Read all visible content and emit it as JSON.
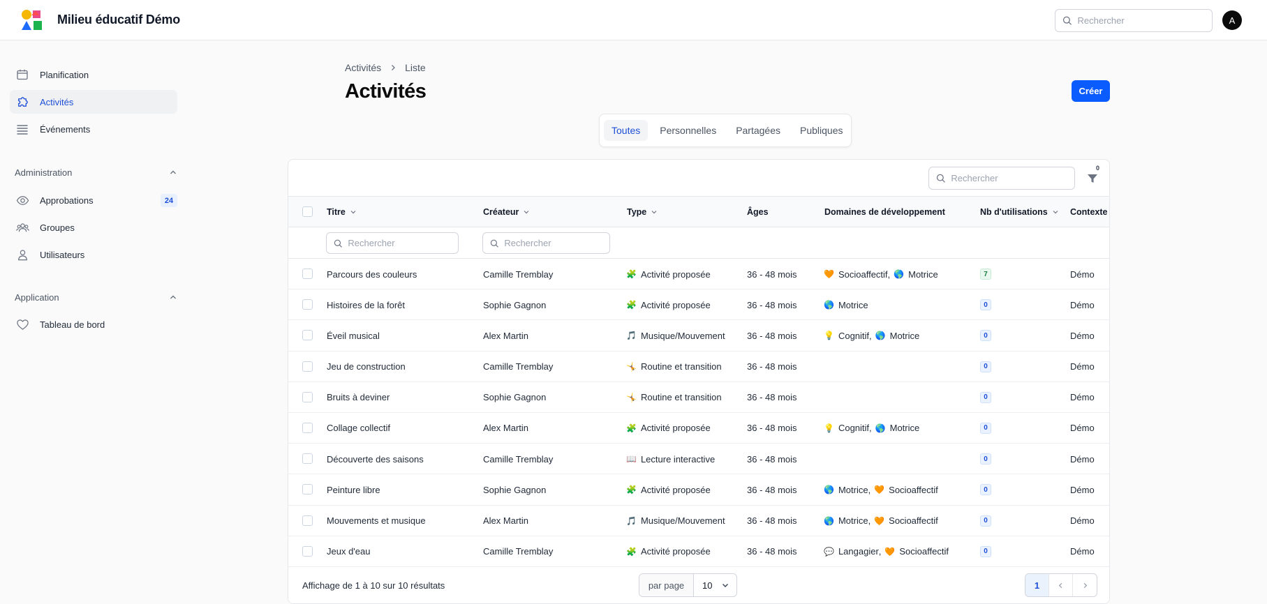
{
  "app": {
    "title": "Milieu éducatif Démo",
    "search_placeholder": "Rechercher",
    "avatar_initial": "A",
    "accent_color": "#0b5cff"
  },
  "sidebar": {
    "items": [
      {
        "label": "Planification",
        "icon": "calendar-icon"
      },
      {
        "label": "Activités",
        "icon": "puzzle-icon",
        "active": true
      },
      {
        "label": "Événements",
        "icon": "list-icon"
      }
    ],
    "sections": [
      {
        "title": "Administration",
        "items": [
          {
            "label": "Approbations",
            "icon": "eye-icon",
            "badge": "24"
          },
          {
            "label": "Groupes",
            "icon": "users-icon"
          },
          {
            "label": "Utilisateurs",
            "icon": "user-icon"
          }
        ]
      },
      {
        "title": "Application",
        "items": [
          {
            "label": "Tableau de bord",
            "icon": "heart-icon"
          }
        ]
      }
    ]
  },
  "main": {
    "breadcrumb": [
      "Activités",
      "Liste"
    ],
    "title": "Activités",
    "create_label": "Créer",
    "tabs": [
      "Toutes",
      "Personnelles",
      "Partagées",
      "Publiques"
    ],
    "active_tab": 0,
    "table_search_placeholder": "Rechercher",
    "filter_count": "0"
  },
  "table": {
    "columns": [
      "Titre",
      "Créateur",
      "Type",
      "Âges",
      "Domaines de développement",
      "Nb d'utilisations",
      "Contexte"
    ],
    "column_search_placeholder": "Rechercher",
    "rows": [
      {
        "title": "Parcours des couleurs",
        "creator": "Camille Tremblay",
        "type_emoji": "🧩",
        "type": "Activité proposée",
        "ages": "36 - 48 mois",
        "domains": [
          {
            "emoji": "🧡",
            "name": "Socioaffectif"
          },
          {
            "emoji": "🌎",
            "name": "Motrice"
          }
        ],
        "uses": "7",
        "context": "Démo"
      },
      {
        "title": "Histoires de la forêt",
        "creator": "Sophie Gagnon",
        "type_emoji": "🧩",
        "type": "Activité proposée",
        "ages": "36 - 48 mois",
        "domains": [
          {
            "emoji": "🌎",
            "name": "Motrice"
          }
        ],
        "uses": "0",
        "context": "Démo"
      },
      {
        "title": "Éveil musical",
        "creator": "Alex Martin",
        "type_emoji": "🎵",
        "type": "Musique/Mouvement",
        "ages": "36 - 48 mois",
        "domains": [
          {
            "emoji": "💡",
            "name": "Cognitif"
          },
          {
            "emoji": "🌎",
            "name": "Motrice"
          }
        ],
        "uses": "0",
        "context": "Démo"
      },
      {
        "title": "Jeu de construction",
        "creator": "Camille Tremblay",
        "type_emoji": "🤸",
        "type": "Routine et transition",
        "ages": "36 - 48 mois",
        "domains": [],
        "uses": "0",
        "context": "Démo"
      },
      {
        "title": "Bruits à deviner",
        "creator": "Sophie Gagnon",
        "type_emoji": "🤸",
        "type": "Routine et transition",
        "ages": "36 - 48 mois",
        "domains": [],
        "uses": "0",
        "context": "Démo"
      },
      {
        "title": "Collage collectif",
        "creator": "Alex Martin",
        "type_emoji": "🧩",
        "type": "Activité proposée",
        "ages": "36 - 48 mois",
        "domains": [
          {
            "emoji": "💡",
            "name": "Cognitif"
          },
          {
            "emoji": "🌎",
            "name": "Motrice"
          }
        ],
        "uses": "0",
        "context": "Démo"
      },
      {
        "title": "Découverte des saisons",
        "creator": "Camille Tremblay",
        "type_emoji": "📖",
        "type": "Lecture interactive",
        "ages": "36 - 48 mois",
        "domains": [],
        "uses": "0",
        "context": "Démo"
      },
      {
        "title": "Peinture libre",
        "creator": "Sophie Gagnon",
        "type_emoji": "🧩",
        "type": "Activité proposée",
        "ages": "36 - 48 mois",
        "domains": [
          {
            "emoji": "🌎",
            "name": "Motrice"
          },
          {
            "emoji": "🧡",
            "name": "Socioaffectif"
          }
        ],
        "uses": "0",
        "context": "Démo"
      },
      {
        "title": "Mouvements et musique",
        "creator": "Alex Martin",
        "type_emoji": "🎵",
        "type": "Musique/Mouvement",
        "ages": "36 - 48 mois",
        "domains": [
          {
            "emoji": "🌎",
            "name": "Motrice"
          },
          {
            "emoji": "🧡",
            "name": "Socioaffectif"
          }
        ],
        "uses": "0",
        "context": "Démo"
      },
      {
        "title": "Jeux d'eau",
        "creator": "Camille Tremblay",
        "type_emoji": "🧩",
        "type": "Activité proposée",
        "ages": "36 - 48 mois",
        "domains": [
          {
            "emoji": "💬",
            "name": "Langagier"
          },
          {
            "emoji": "🧡",
            "name": "Socioaffectif"
          }
        ],
        "uses": "0",
        "context": "Démo"
      }
    ]
  },
  "footer": {
    "result_text": "Affichage de 1 à 10 sur 10 résultats",
    "per_page_label": "par page",
    "per_page_value": "10",
    "current_page": "1"
  }
}
